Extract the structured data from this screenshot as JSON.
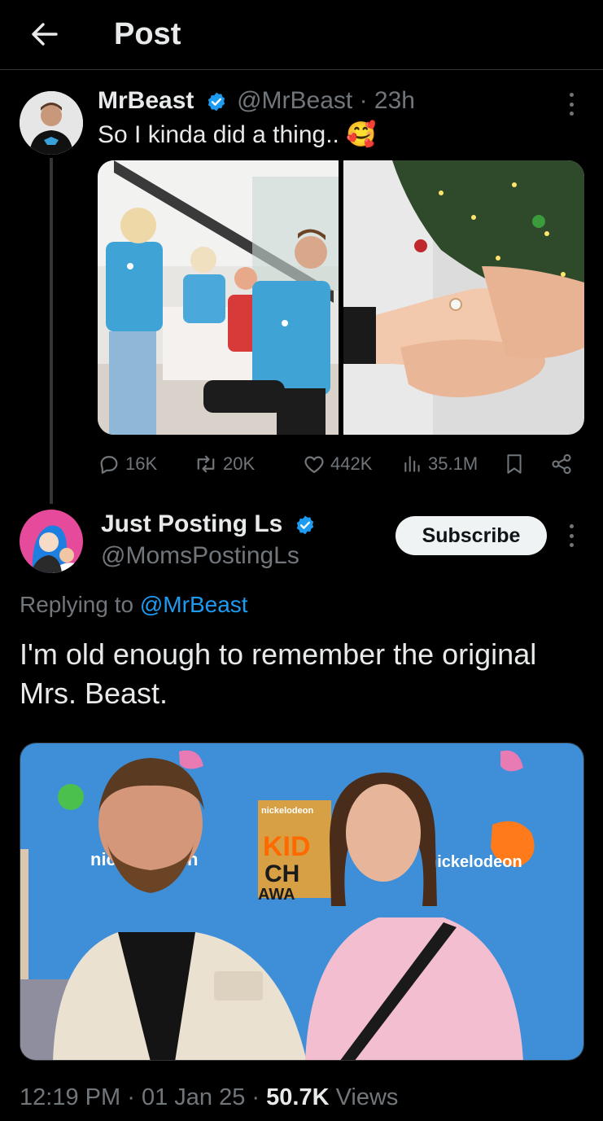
{
  "header": {
    "title": "Post",
    "back_icon": "arrow-left-icon"
  },
  "tweet": {
    "author_name": "MrBeast",
    "author_handle": "@MrBeast",
    "separator": "·",
    "time_ago": "23h",
    "text": "So I kinda did a thing..",
    "emoji": "🥰",
    "stats": {
      "replies": "16K",
      "reposts": "20K",
      "likes": "442K",
      "views": "35.1M"
    }
  },
  "reply": {
    "author_name": "Just Posting Ls",
    "author_handle": "@MomsPostingLs",
    "subscribe_label": "Subscribe",
    "replying_prefix": "Replying to",
    "replying_to": "@MrBeast",
    "text": "I'm old enough to remember the original Mrs. Beast.",
    "image_text": {
      "brand_left": "nic",
      "brand_left_end": "n",
      "brand_right": "nickelodeon",
      "logo_small": "nickelodeon",
      "logo_line1": "KID",
      "logo_line2": "CH",
      "logo_line3": "AWA"
    }
  },
  "meta": {
    "time": "12:19 PM",
    "date": "01 Jan 25",
    "dot": "·",
    "views_count": "50.7K",
    "views_label": "Views"
  },
  "colors": {
    "background": "#000000",
    "text": "#e7e9ea",
    "muted": "#71767b",
    "accent": "#1d9bf0",
    "verified": "#1d9bf0"
  }
}
